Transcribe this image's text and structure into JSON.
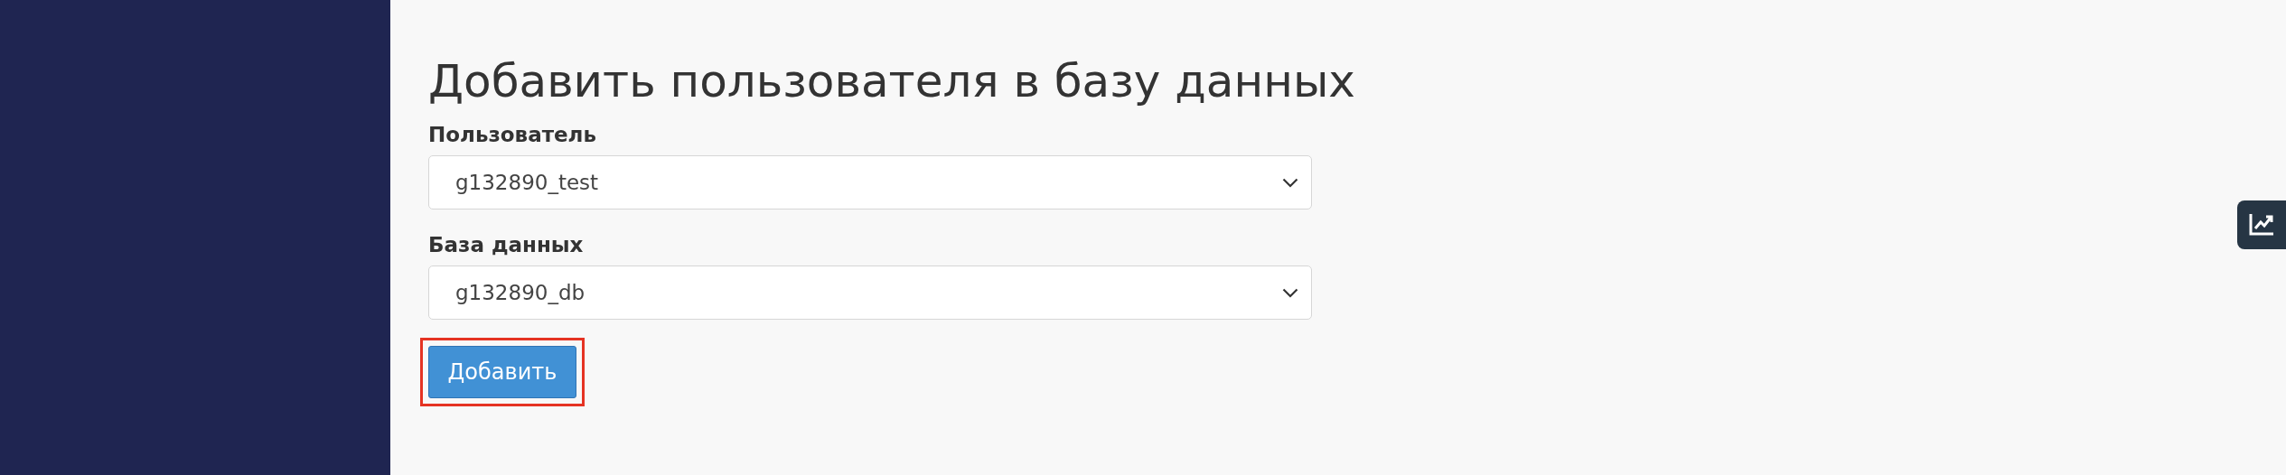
{
  "title": "Добавить пользователя в базу данных",
  "fields": [
    {
      "label": "Пользователь",
      "value": "g132890_test"
    },
    {
      "label": "База данных",
      "value": "g132890_db"
    }
  ],
  "submit": {
    "label": "Добавить",
    "highlighted": true
  }
}
